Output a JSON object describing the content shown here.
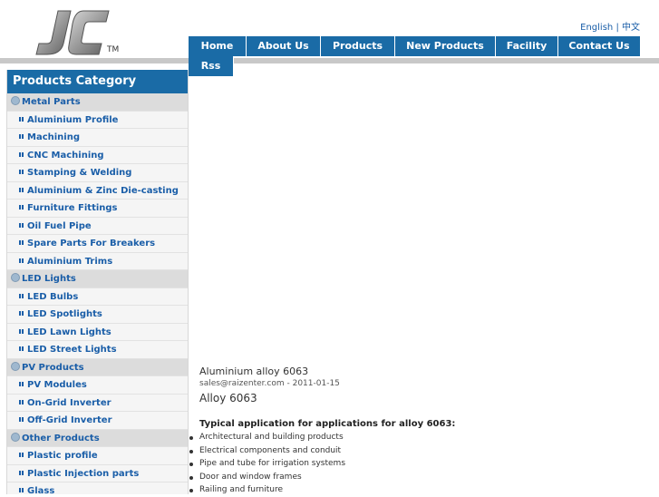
{
  "header": {
    "logo_text": "JC",
    "tm": "TM",
    "lang_english": "English",
    "lang_sep": "|",
    "lang_chinese": "中文"
  },
  "nav": [
    "Home",
    "About Us",
    "Products",
    "New Products",
    "Facility",
    "Contact Us",
    "Rss"
  ],
  "sidebar": {
    "title": "Products Category",
    "rows": [
      {
        "type": "group",
        "label": "Metal Parts"
      },
      {
        "type": "item",
        "label": "Aluminium Profile"
      },
      {
        "type": "item",
        "label": "Machining"
      },
      {
        "type": "item",
        "label": "CNC Machining"
      },
      {
        "type": "item",
        "label": "Stamping & Welding"
      },
      {
        "type": "item",
        "label": "Aluminium & Zinc Die-casting"
      },
      {
        "type": "item",
        "label": "Furniture Fittings"
      },
      {
        "type": "item",
        "label": "Oil Fuel Pipe"
      },
      {
        "type": "item",
        "label": "Spare Parts For Breakers"
      },
      {
        "type": "item",
        "label": "Aluminium Trims"
      },
      {
        "type": "group",
        "label": "LED Lights"
      },
      {
        "type": "item",
        "label": "LED Bulbs"
      },
      {
        "type": "item",
        "label": "LED Spotlights"
      },
      {
        "type": "item",
        "label": "LED Lawn Lights"
      },
      {
        "type": "item",
        "label": "LED Street Lights"
      },
      {
        "type": "group",
        "label": "PV Products"
      },
      {
        "type": "item",
        "label": "PV Modules"
      },
      {
        "type": "item",
        "label": "On-Grid Inverter"
      },
      {
        "type": "item",
        "label": "Off-Grid Inverter"
      },
      {
        "type": "group",
        "label": "Other Products"
      },
      {
        "type": "item",
        "label": "Plastic profile"
      },
      {
        "type": "item",
        "label": "Plastic Injection parts"
      },
      {
        "type": "item",
        "label": "Glass"
      }
    ]
  },
  "article": {
    "title": "Aluminium alloy 6063",
    "meta": "sales@raizenter.com - 2011-01-15",
    "heading": "Alloy 6063",
    "lead": "Typical application for applications for alloy 6063:",
    "items": [
      "Architectural and building products",
      "Electrical components and conduit",
      "Pipe and tube for irrigation systems",
      "Door and window frames",
      "Railing and furniture"
    ]
  },
  "colors": {
    "accent": "#1a6ba6",
    "link": "#1a5ea8"
  }
}
